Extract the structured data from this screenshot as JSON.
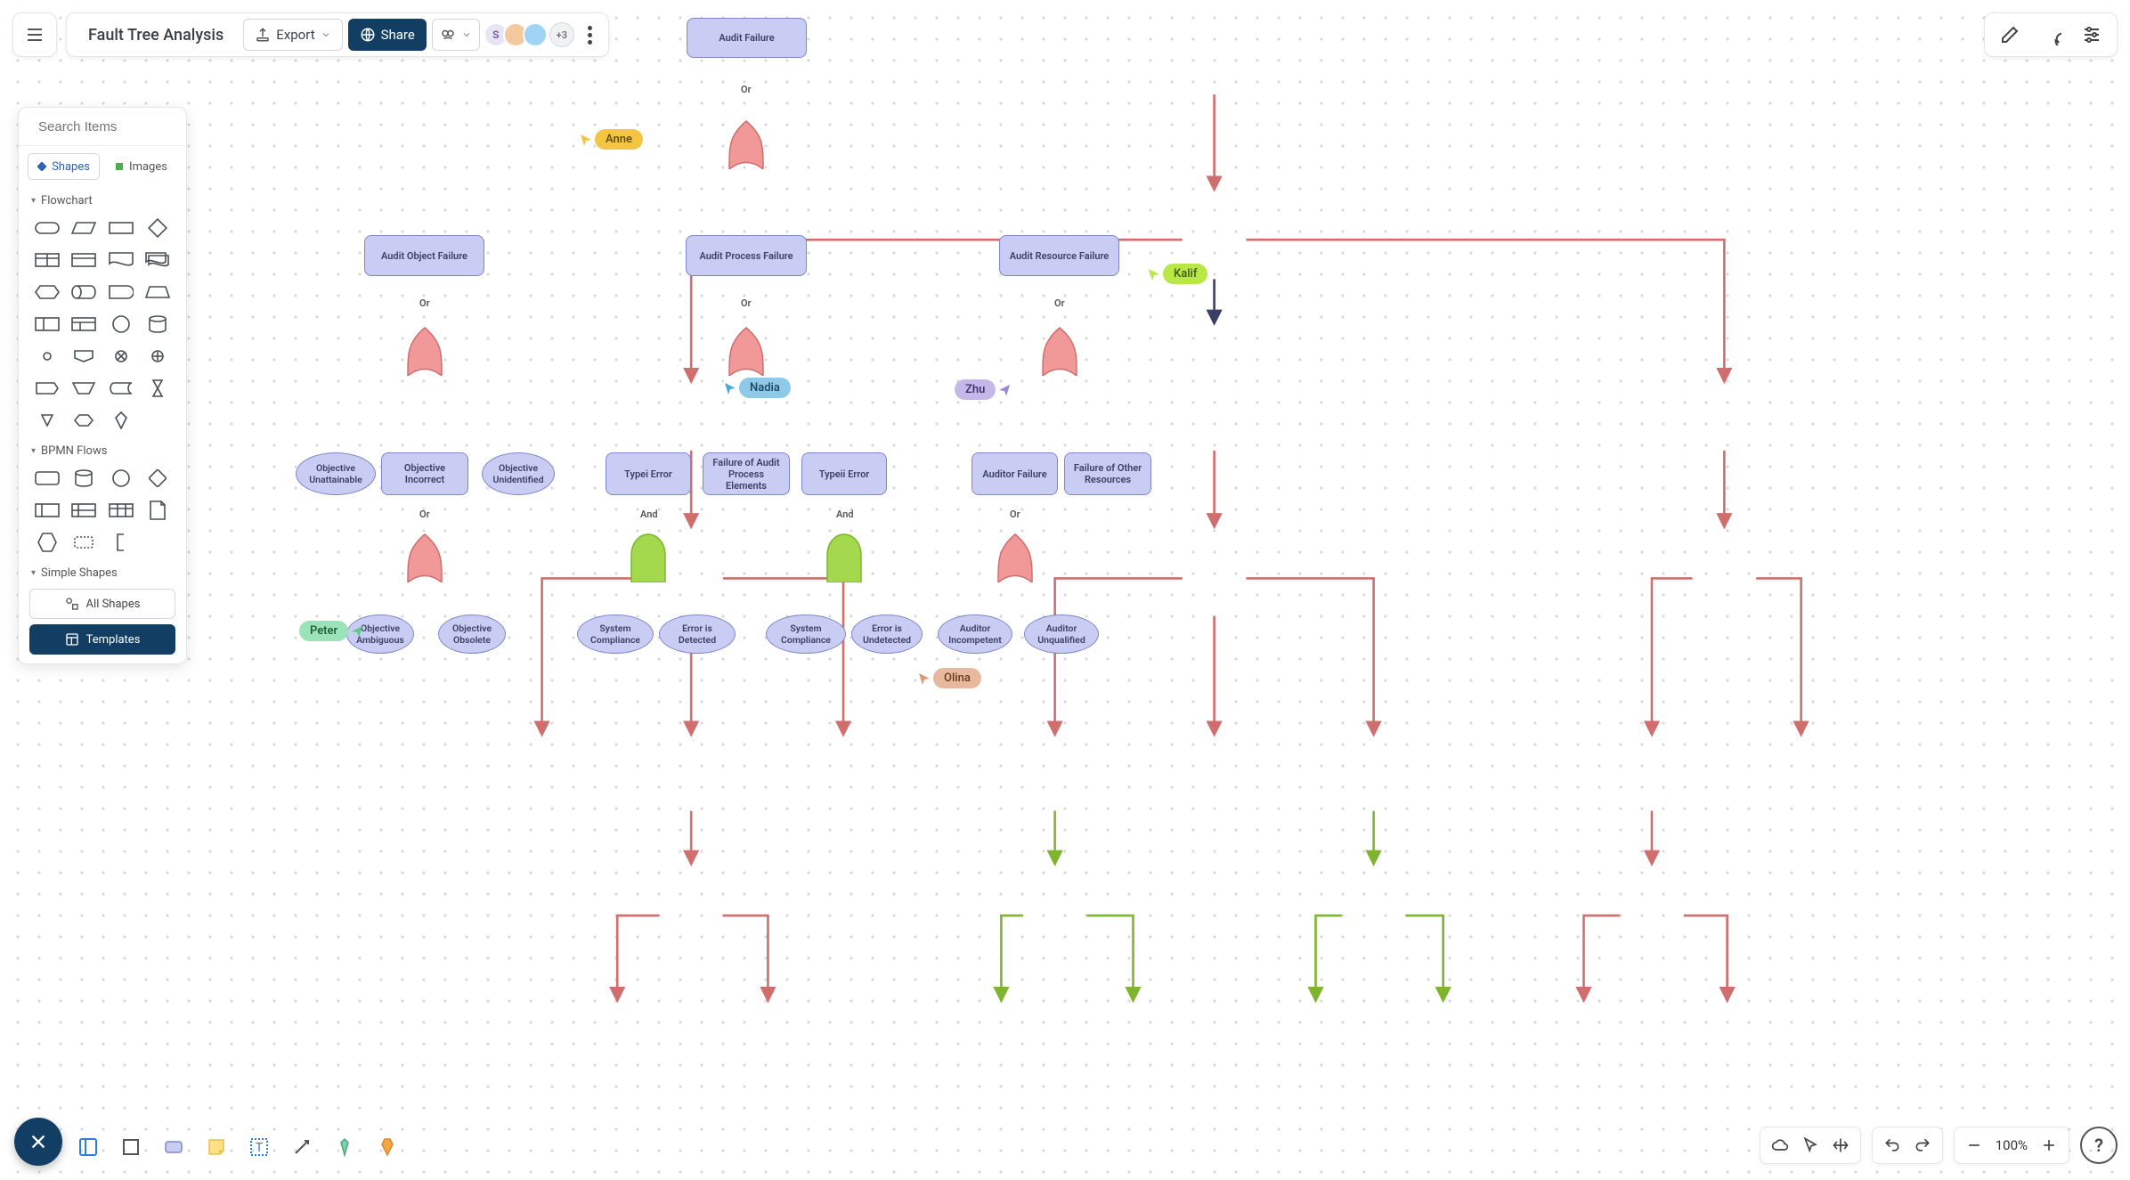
{
  "doc": {
    "title": "Fault Tree Analysis"
  },
  "toolbar": {
    "export": "Export",
    "share": "Share",
    "avatars": {
      "first_initial": "S",
      "more": "+3"
    }
  },
  "sidebar": {
    "search_placeholder": "Search Items",
    "tab_shapes": "Shapes",
    "tab_images": "Images",
    "section_flowchart": "Flowchart",
    "section_bpmn": "BPMN Flows",
    "section_simple": "Simple Shapes",
    "all_shapes": "All Shapes",
    "templates": "Templates"
  },
  "zoom": {
    "value": "100%"
  },
  "cursors": {
    "anne": "Anne",
    "kalif": "Kalif",
    "nadia": "Nadia",
    "zhu": "Zhu",
    "peter": "Peter",
    "olina": "Olina"
  },
  "nodes": {
    "root": "Audit Failure",
    "l1a": "Audit Object Failure",
    "l1b": "Audit Process Failure",
    "l1c": "Audit Resource Failure",
    "l2a1": "Objective Unattainable",
    "l2a2": "Objective Incorrect",
    "l2a3": "Objective Unidentified",
    "l2b1": "Typei Error",
    "l2b2": "Failure  of Audit Process Elements",
    "l2b3": "Typeii Error",
    "l2c1": "Auditor Failure",
    "l2c2": "Failure of Other Resources",
    "l3a2a": "Objective Ambiguous",
    "l3a2b": "Objective Obsolete",
    "l3b1a": "System Compliance",
    "l3b1b": "Error is Detected",
    "l3b3a": "System Compliance",
    "l3b3b": "Error is Undetected",
    "l3c1a": "Auditor Incompetent",
    "l3c1b": "Auditor Unqualified"
  },
  "gates": {
    "or": "Or",
    "and": "And"
  },
  "chart_data": {
    "type": "fault_tree",
    "root": {
      "id": "root",
      "label": "Audit Failure",
      "gate": "or",
      "children": [
        {
          "id": "l1a",
          "label": "Audit Object Failure",
          "gate": "or",
          "children": [
            {
              "id": "l2a1",
              "label": "Objective Unattainable"
            },
            {
              "id": "l2a2",
              "label": "Objective Incorrect",
              "gate": "or",
              "children": [
                {
                  "id": "l3a2a",
                  "label": "Objective Ambiguous"
                },
                {
                  "id": "l3a2b",
                  "label": "Objective Obsolete"
                }
              ]
            },
            {
              "id": "l2a3",
              "label": "Objective Unidentified"
            }
          ]
        },
        {
          "id": "l1b",
          "label": "Audit Process Failure",
          "gate": "or",
          "children": [
            {
              "id": "l2b1",
              "label": "Typei Error",
              "gate": "and",
              "children": [
                {
                  "id": "l3b1a",
                  "label": "System Compliance"
                },
                {
                  "id": "l3b1b",
                  "label": "Error is Detected"
                }
              ]
            },
            {
              "id": "l2b2",
              "label": "Failure of Audit Process Elements"
            },
            {
              "id": "l2b3",
              "label": "Typeii Error",
              "gate": "and",
              "children": [
                {
                  "id": "l3b3a",
                  "label": "System Compliance"
                },
                {
                  "id": "l3b3b",
                  "label": "Error is Undetected"
                }
              ]
            },
            {
              "id": "l2c1",
              "label": "Auditor Failure",
              "gate": "or",
              "children": [
                {
                  "id": "l3c1a",
                  "label": "Auditor Incompetent"
                },
                {
                  "id": "l3c1b",
                  "label": "Auditor Unqualified"
                }
              ]
            },
            {
              "id": "l2c2",
              "label": "Failure of Other Resources"
            }
          ]
        },
        {
          "id": "l1c",
          "label": "Audit Resource Failure",
          "gate": "or",
          "children": [
            {
              "id": "l2c1",
              "label": "Auditor Failure"
            },
            {
              "id": "l2c2",
              "label": "Failure of Other Resources"
            }
          ]
        }
      ]
    }
  }
}
